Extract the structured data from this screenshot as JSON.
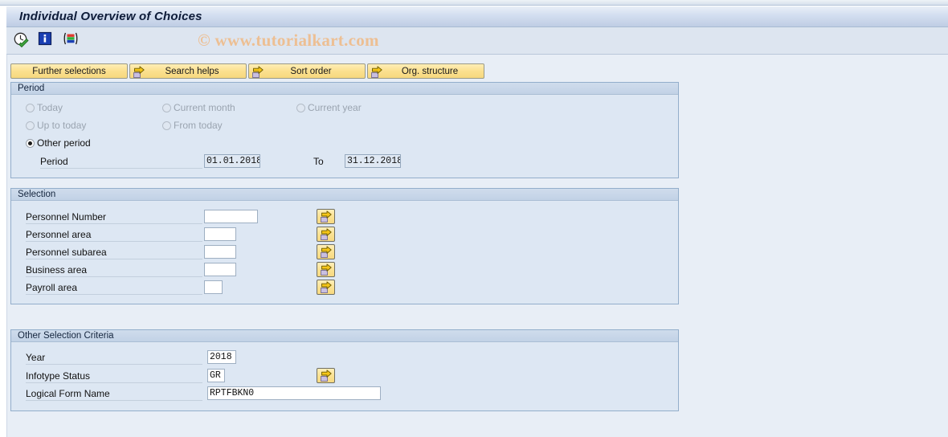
{
  "window": {
    "title": "Individual Overview of Choices"
  },
  "watermark": {
    "text": "© www.tutorialkart.com"
  },
  "toolbar": {
    "icons": [
      {
        "name": "execute-clock-check-icon",
        "label": "Execute"
      },
      {
        "name": "info-icon",
        "label": "Information"
      },
      {
        "name": "variant-icon",
        "label": "Get Variant"
      }
    ]
  },
  "buttons": [
    {
      "label": "Further selections",
      "icon": false
    },
    {
      "label": "Search helps",
      "icon": true
    },
    {
      "label": "Sort order",
      "icon": true
    },
    {
      "label": "Org. structure",
      "icon": true
    }
  ],
  "period": {
    "title": "Period",
    "options": [
      {
        "label": "Today",
        "selected": false,
        "disabled": true
      },
      {
        "label": "Current month",
        "selected": false,
        "disabled": true
      },
      {
        "label": "Current year",
        "selected": false,
        "disabled": true
      },
      {
        "label": "Up to today",
        "selected": false,
        "disabled": true
      },
      {
        "label": "From today",
        "selected": false,
        "disabled": true
      },
      {
        "label": "Other period",
        "selected": true,
        "disabled": false
      }
    ],
    "period_label": "Period",
    "period_from": "01.01.2018",
    "to_label": "To",
    "period_to": "31.12.2018"
  },
  "selection": {
    "title": "Selection",
    "rows": [
      {
        "label": "Personnel Number",
        "value": "",
        "placeholder": ""
      },
      {
        "label": "Personnel area",
        "value": "",
        "placeholder": ""
      },
      {
        "label": "Personnel subarea",
        "value": "",
        "placeholder": ""
      },
      {
        "label": "Business area",
        "value": "",
        "placeholder": ""
      },
      {
        "label": "Payroll area",
        "value": "",
        "placeholder": ""
      }
    ]
  },
  "other_criteria": {
    "title": "Other Selection Criteria",
    "year_label": "Year",
    "year_value": "2018",
    "infotype_label": "Infotype Status",
    "infotype_value": "GR",
    "form_label": "Logical Form Name",
    "form_value": "RPTFBKN0"
  },
  "colors": {
    "title_text": "#0d1b38",
    "button_yellow": "#fbe08e",
    "group_border": "#93aecb",
    "canvas_bg": "#e8eef6",
    "watermark": "#edbf93"
  }
}
